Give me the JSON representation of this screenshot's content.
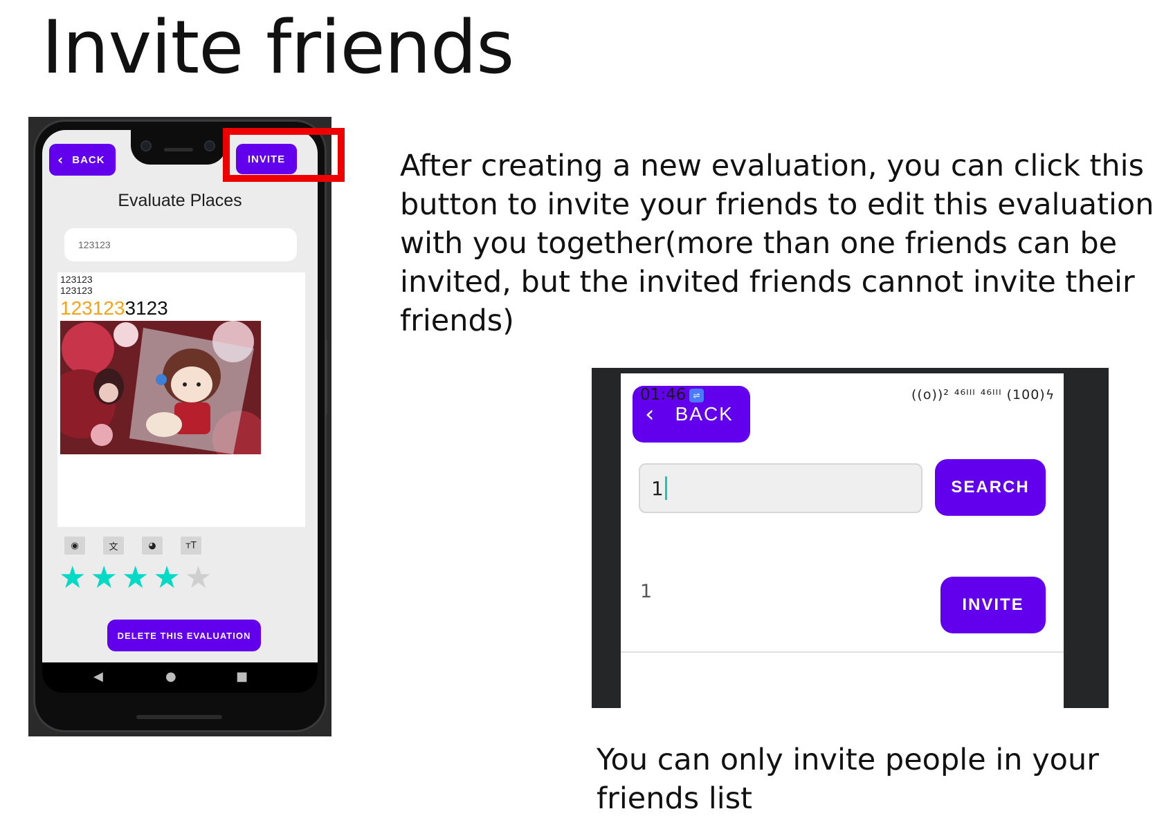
{
  "slide": {
    "title": "Invite friends",
    "explanation": "After creating a new evaluation, you can click this button to invite your friends to edit this evaluation with you together(more than one friends can be invited, but the invited friends cannot invite their friends)",
    "caption": "You can only invite people in your friends list"
  },
  "phone": {
    "back_label": "BACK",
    "invite_label": "INVITE",
    "heading": "Evaluate Places",
    "name_input_value": "123123",
    "content_line1": "123123",
    "content_line2": "123123",
    "content_big_orange": "123123",
    "content_big_black": "3123",
    "tools": [
      "camera-icon",
      "translate-icon",
      "palette-icon",
      "text-size-icon"
    ],
    "rating": {
      "value": 4,
      "max": 5
    },
    "delete_label": "DELETE THIS EVALUATION",
    "colors": {
      "accent": "#6200ee",
      "star": "#03dac5",
      "orange": "#f5a31a",
      "highlight": "#ee0000"
    }
  },
  "invite_screen": {
    "time": "01:46",
    "status_icons": "((o))² ⁴⁶ᴵᴵᴵ ⁴⁶ᴵᴵᴵ (100)ϟ",
    "back_label": "BACK",
    "search_value": "1",
    "search_label": "SEARCH",
    "result_name": "1",
    "invite_label": "INVITE"
  }
}
